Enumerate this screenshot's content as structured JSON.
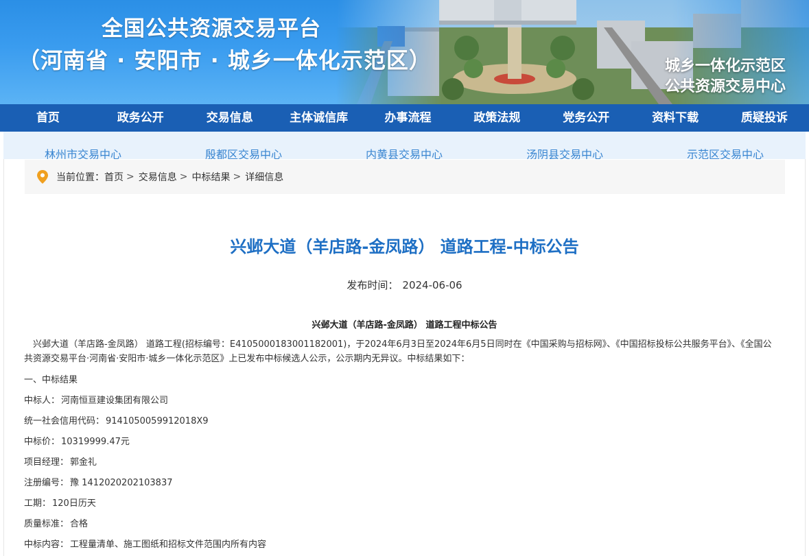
{
  "banner": {
    "title_line1": "全国公共资源交易平台",
    "title_line2": "（河南省 · 安阳市 · 城乡一体化示范区）",
    "subtitle_line1": "城乡一体化示范区",
    "subtitle_line2": "公共资源交易中心"
  },
  "main_nav": [
    {
      "label": "首页"
    },
    {
      "label": "政务公开"
    },
    {
      "label": "交易信息"
    },
    {
      "label": "主体诚信库"
    },
    {
      "label": "办事流程"
    },
    {
      "label": "政策法规"
    },
    {
      "label": "党务公开"
    },
    {
      "label": "资料下载"
    },
    {
      "label": "质疑投诉"
    }
  ],
  "sub_nav": [
    {
      "label": "林州市交易中心"
    },
    {
      "label": "殷都区交易中心"
    },
    {
      "label": "内黄县交易中心"
    },
    {
      "label": "汤阴县交易中心"
    },
    {
      "label": "示范区交易中心"
    }
  ],
  "breadcrumb": {
    "prefix": "当前位置：",
    "items": [
      "首页",
      "交易信息",
      "中标结果",
      "详细信息"
    ],
    "separator": ">"
  },
  "article": {
    "title": "兴邺大道（羊店路-金凤路） 道路工程-中标公告",
    "publish_label": "发布时间：",
    "publish_date": "2024-06-06",
    "heading": "兴邺大道（羊店路-金凤路） 道路工程中标公告",
    "intro": "兴邺大道（羊店路-金凤路） 道路工程(招标编号：E4105000183001182001)，于2024年6月3日至2024年6月5日同时在《中国采购与招标网》、《中国招标投标公共服务平台》、《全国公共资源交易平台·河南省·安阳市·城乡一体化示范区》上已发布中标候选人公示，公示期内无异议。中标结果如下：",
    "section_1": "一、中标结果",
    "fields": [
      {
        "label": "中标人：",
        "value": "河南恒亘建设集团有限公司"
      },
      {
        "label": "统一社会信用代码：",
        "value": "9141050059912018X9"
      },
      {
        "label": "中标价：",
        "value": "10319999.47元"
      },
      {
        "label": "项目经理：",
        "value": "郭金礼"
      },
      {
        "label": "注册编号：",
        "value": "豫 1412020202103837"
      },
      {
        "label": "工期：",
        "value": "120日历天"
      },
      {
        "label": "质量标准：",
        "value": "合格"
      },
      {
        "label": "中标内容：",
        "value": "工程量清单、施工图纸和招标文件范围内所有内容"
      }
    ]
  },
  "colors": {
    "nav_bg": "#1a5fb4",
    "subnav_bg": "#e8f2fc",
    "subnav_text": "#3a86d1",
    "title_blue": "#1e6fc4",
    "location_pin": "#f0a020"
  },
  "icons": {
    "breadcrumb": "location-pin-icon"
  }
}
